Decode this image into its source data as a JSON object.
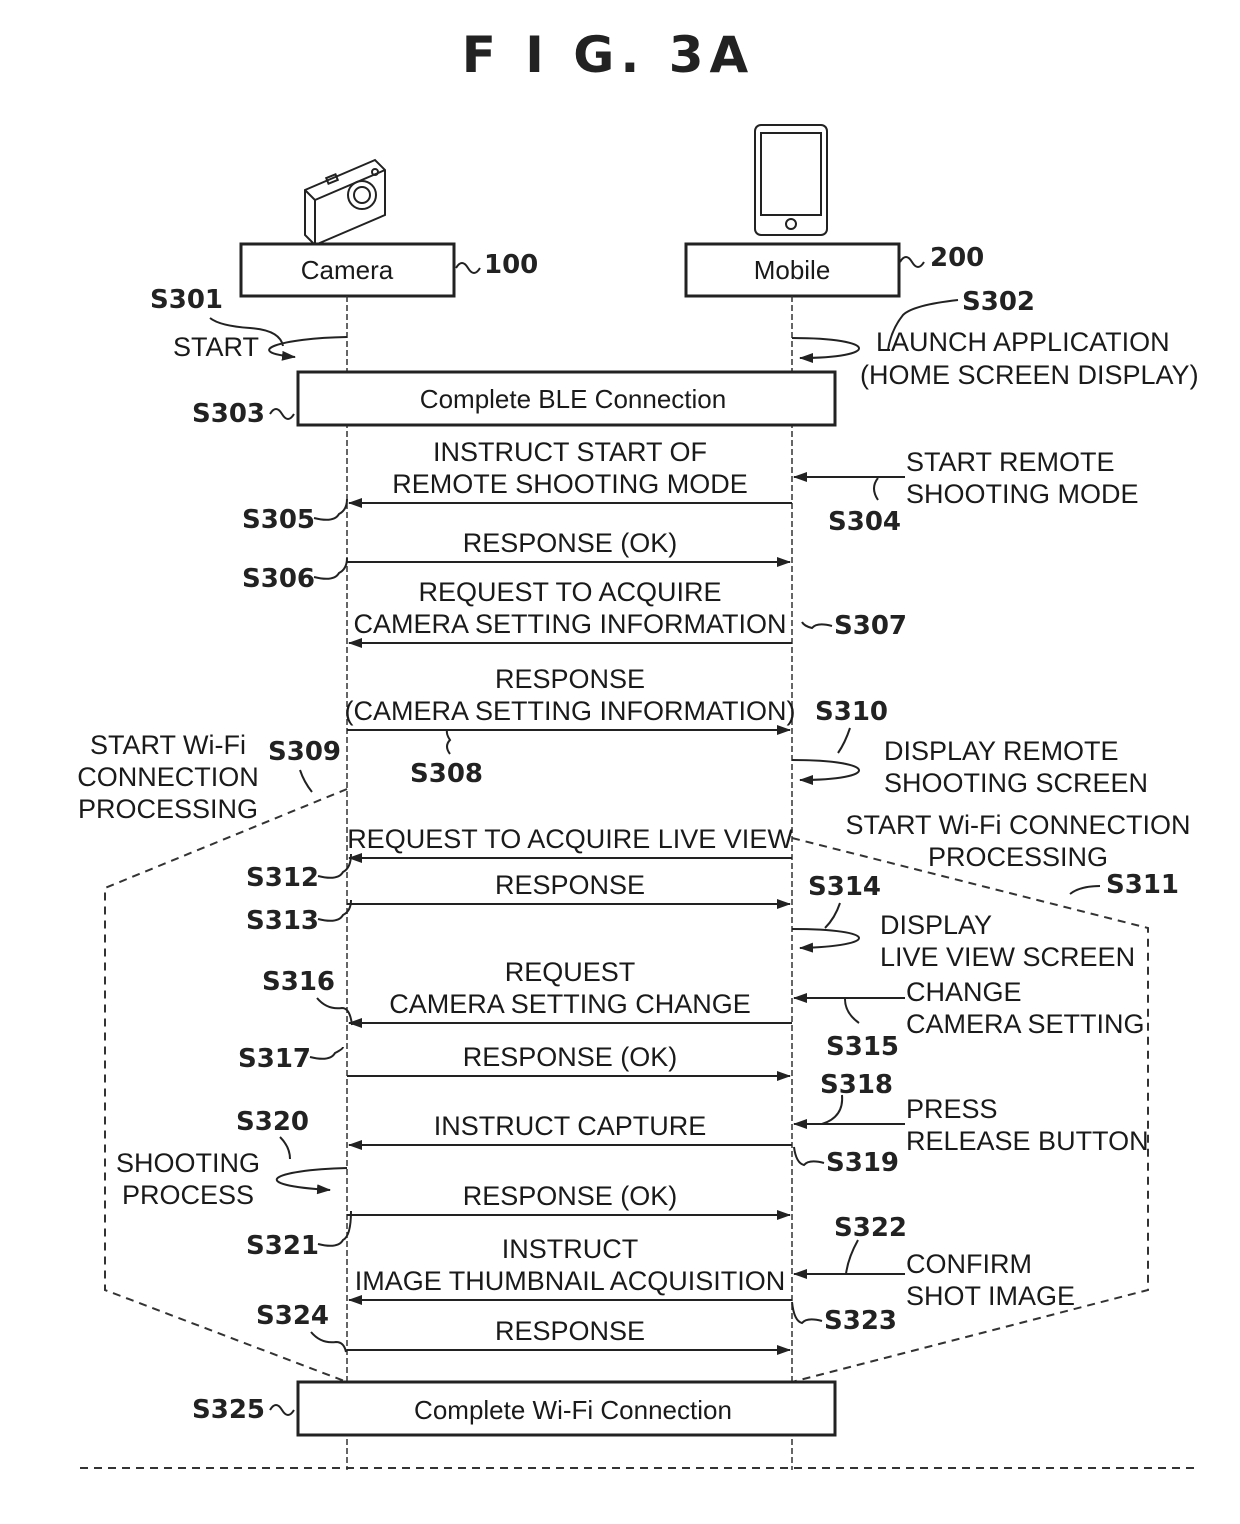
{
  "figure": {
    "title": "F I G.  3A"
  },
  "actors": {
    "camera": {
      "label": "Camera",
      "ref": "100",
      "icon": "camera-icon"
    },
    "mobile": {
      "label": "Mobile",
      "ref": "200",
      "icon": "smartphone-icon"
    }
  },
  "bars": {
    "ble": {
      "label": "Complete BLE Connection",
      "step": "S303"
    },
    "wifi": {
      "label": "Complete Wi-Fi Connection",
      "step": "S325"
    }
  },
  "self_notes": {
    "s301": {
      "step": "S301",
      "lines": [
        "START"
      ]
    },
    "s302": {
      "step": "S302",
      "lines": [
        "LAUNCH APPLICATION",
        "(HOME SCREEN DISPLAY)"
      ]
    },
    "s310": {
      "step": "S310",
      "lines": [
        "DISPLAY REMOTE",
        "SHOOTING SCREEN"
      ]
    },
    "s314": {
      "step": "S314",
      "lines": [
        "DISPLAY",
        "LIVE VIEW SCREEN"
      ]
    },
    "s320": {
      "step": "S320",
      "lines": [
        "SHOOTING",
        "PROCESS"
      ]
    }
  },
  "side_notes": {
    "s304": {
      "step": "S304",
      "lines": [
        "START REMOTE",
        "SHOOTING MODE"
      ]
    },
    "s315": {
      "step": "S315",
      "lines": [
        "CHANGE",
        "CAMERA SETTING"
      ]
    },
    "s318": {
      "step": "S318",
      "lines": [
        "PRESS",
        "RELEASE BUTTON"
      ]
    },
    "s322": {
      "step": "S322",
      "lines": [
        "CONFIRM",
        "SHOT IMAGE"
      ]
    }
  },
  "wifi_processing": {
    "left": {
      "step": "S309",
      "lines": [
        "START Wi-Fi",
        "CONNECTION",
        "PROCESSING"
      ]
    },
    "right": {
      "step": "S311",
      "lines": [
        "START Wi-Fi CONNECTION",
        "PROCESSING"
      ]
    }
  },
  "messages": [
    {
      "id": "m305",
      "step": "S305",
      "direction": "to-camera",
      "lines": [
        "INSTRUCT START OF",
        "REMOTE SHOOTING MODE"
      ]
    },
    {
      "id": "m306",
      "step": "S306",
      "direction": "to-mobile",
      "lines": [
        "RESPONSE (OK)"
      ]
    },
    {
      "id": "m307",
      "step": "S307",
      "direction": "to-camera",
      "lines": [
        "REQUEST TO ACQUIRE",
        "CAMERA SETTING INFORMATION"
      ]
    },
    {
      "id": "m308",
      "step": "S308",
      "direction": "to-mobile",
      "lines": [
        "RESPONSE",
        "(CAMERA SETTING INFORMATION)"
      ]
    },
    {
      "id": "m312",
      "step": "S312",
      "direction": "to-camera",
      "lines": [
        "REQUEST TO ACQUIRE LIVE VIEW"
      ]
    },
    {
      "id": "m313",
      "step": "S313",
      "direction": "to-mobile",
      "lines": [
        "RESPONSE"
      ]
    },
    {
      "id": "m316",
      "step": "S316",
      "direction": "to-camera",
      "lines": [
        "REQUEST",
        "CAMERA SETTING CHANGE"
      ]
    },
    {
      "id": "m317",
      "step": "S317",
      "direction": "to-mobile",
      "lines": [
        "RESPONSE (OK)"
      ]
    },
    {
      "id": "m319",
      "step": "S319",
      "direction": "to-camera",
      "lines": [
        "INSTRUCT CAPTURE"
      ]
    },
    {
      "id": "m321",
      "step": "S321",
      "direction": "to-mobile",
      "lines": [
        "RESPONSE (OK)"
      ]
    },
    {
      "id": "m323",
      "step": "S323",
      "direction": "to-camera",
      "lines": [
        "INSTRUCT",
        "IMAGE THUMBNAIL ACQUISITION"
      ]
    },
    {
      "id": "m324",
      "step": "S324",
      "direction": "to-mobile",
      "lines": [
        "RESPONSE"
      ]
    }
  ]
}
